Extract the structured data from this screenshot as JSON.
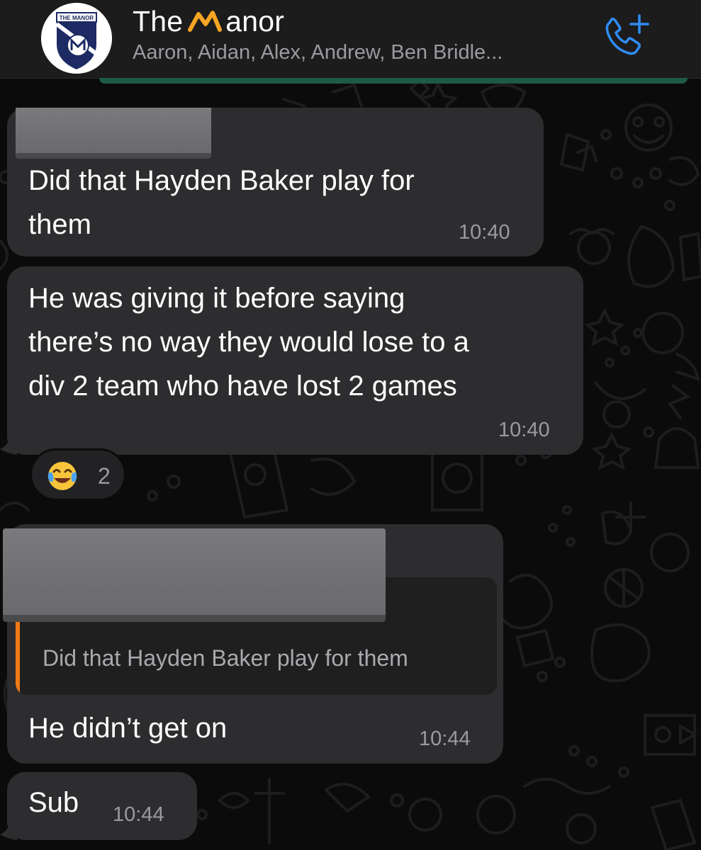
{
  "header": {
    "title_prefix": "The",
    "title_suffix": "anor",
    "subtitle": "Aaron, Aidan, Alex, Andrew, Ben Bridle...",
    "avatar_text": "THE MANOR",
    "call_icon": "phone-add-icon"
  },
  "messages": [
    {
      "text": "Did that Hayden Baker play for\nthem",
      "time": "10:40",
      "sender_redacted": true
    },
    {
      "text": "He was giving it before saying\nthere’s no way they would lose to a\ndiv 2 team who have lost 2 games",
      "time": "10:40",
      "reaction": {
        "emoji": "laughing-tears-emoji",
        "count": "2"
      }
    },
    {
      "sender_redacted": true,
      "quote": "Did that Hayden Baker play for them",
      "text": "He didn’t get on",
      "time": "10:44"
    },
    {
      "text": "Sub",
      "time": "10:44"
    }
  ],
  "colors": {
    "background": "#0b0b0b",
    "bubble": "#2d2d2f",
    "header": "#1c1c1d",
    "accent_blue": "#2f8df6",
    "logo_orange": "#f5a524",
    "quote_bar": "#f07a14",
    "muted_text": "#9a9aa0"
  }
}
